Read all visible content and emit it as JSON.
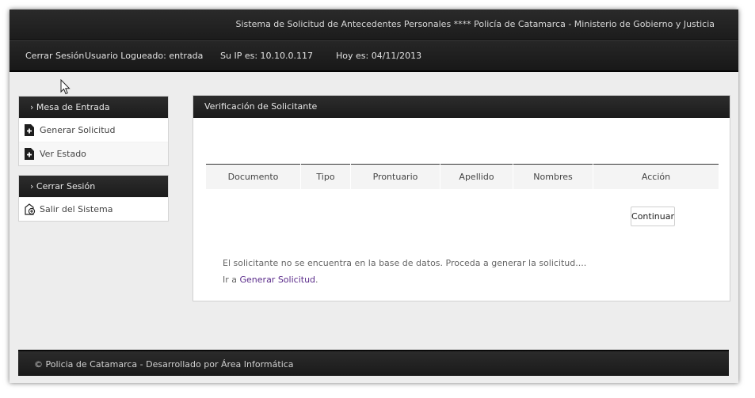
{
  "header": {
    "site_title": "Sistema de Solicitud de Antecedentes Personales **** Policía de Catamarca - Ministerio de Gobierno y Justicia"
  },
  "infobar": {
    "logout": "Cerrar Sesión",
    "user": "Usuario Logueado: entrada",
    "ip": "Su IP es: 10.10.0.117",
    "date": "Hoy es: 04/11/2013"
  },
  "sidebar": {
    "mesa": {
      "title": "› Mesa de Entrada",
      "items": [
        {
          "label": "Generar Solicitud",
          "icon": "add-document-icon"
        },
        {
          "label": "Ver Estado",
          "icon": "add-document-icon"
        }
      ]
    },
    "session": {
      "title": "› Cerrar Sesión",
      "items": [
        {
          "label": "Salir del Sistema",
          "icon": "exit-icon"
        }
      ]
    }
  },
  "main": {
    "title": "Verificación de Solicitante",
    "columns": [
      "Documento",
      "Tipo",
      "Prontuario",
      "Apellido",
      "Nombres",
      "Acción"
    ],
    "continue_button": "Continuar",
    "message": "El solicitante no se encuentra en la base de datos. Proceda a generar la solicitud....",
    "goto_prefix": "Ir a",
    "goto_link": "Generar Solicitud",
    "goto_suffix": "."
  },
  "footer": {
    "text": "© Policia de Catamarca - Desarrollado por Área Informática"
  }
}
